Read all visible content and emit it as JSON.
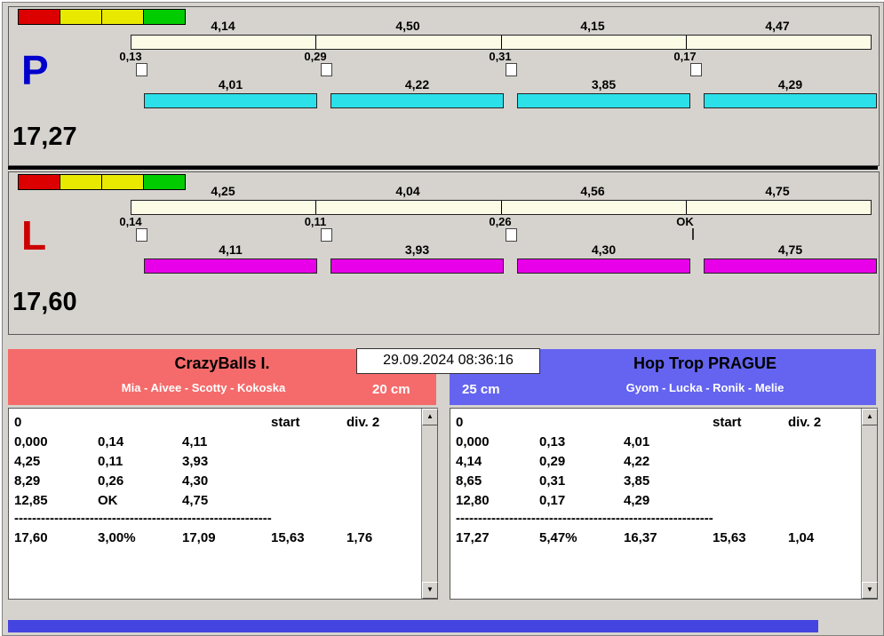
{
  "window": {
    "datetime": "29.09.2024 08:36:16"
  },
  "icons": {
    "scroll_up": "▲",
    "scroll_down": "▼"
  },
  "colors": {
    "lane_p_letter": "#0000cc",
    "lane_l_letter": "#cc0000",
    "split_bar": "#fbfbe6",
    "run_bar_p": "#2ce0ea",
    "run_bar_l": "#e800e8",
    "lights": [
      "#dd0000",
      "#e9e900",
      "#e9e900",
      "#00cc00"
    ],
    "team_left_header": "#f56b6b",
    "team_right_header": "#6464f0",
    "bottom_strip": "#4444e0"
  },
  "lanes": [
    {
      "id": "P",
      "letter": "P",
      "total": "17,27",
      "splits": [
        "4,14",
        "4,50",
        "4,15",
        "4,47"
      ],
      "changes": [
        "0,13",
        "0,29",
        "0,31",
        "0,17"
      ],
      "runs": [
        "4,01",
        "4,22",
        "3,85",
        "4,29"
      ]
    },
    {
      "id": "L",
      "letter": "L",
      "total": "17,60",
      "splits": [
        "4,25",
        "4,04",
        "4,56",
        "4,75"
      ],
      "changes": [
        "0,14",
        "0,11",
        "0,26",
        "OK"
      ],
      "runs": [
        "4,11",
        "3,93",
        "4,30",
        "4,75"
      ]
    }
  ],
  "teams": [
    {
      "name": "CrazyBalls I.",
      "members": "Mia - Aivee - Scotty - Kokoska",
      "jump_height": "20 cm",
      "table": {
        "row0_col1": "0",
        "start_label": "start",
        "div_label": "div. 2",
        "rows": [
          [
            "0,000",
            "0,14",
            "4,11"
          ],
          [
            "4,25",
            "0,11",
            "3,93"
          ],
          [
            "8,29",
            "0,26",
            "4,30"
          ],
          [
            "12,85",
            "OK",
            "4,75"
          ]
        ],
        "separator": "------------------------------------------------------------",
        "totals": [
          "17,60",
          "3,00%",
          "17,09",
          "15,63",
          "1,76"
        ]
      }
    },
    {
      "name": "Hop Trop PRAGUE",
      "members": "Gyom - Lucka - Ronik - Melie",
      "jump_height": "25 cm",
      "table": {
        "row0_col1": "0",
        "start_label": "start",
        "div_label": "div. 2",
        "rows": [
          [
            "0,000",
            "0,13",
            "4,01"
          ],
          [
            "4,14",
            "0,29",
            "4,22"
          ],
          [
            "8,65",
            "0,31",
            "3,85"
          ],
          [
            "12,80",
            "0,17",
            "4,29"
          ]
        ],
        "separator": "------------------------------------------------------------",
        "totals": [
          "17,27",
          "5,47%",
          "16,37",
          "15,63",
          "1,04"
        ]
      }
    }
  ]
}
